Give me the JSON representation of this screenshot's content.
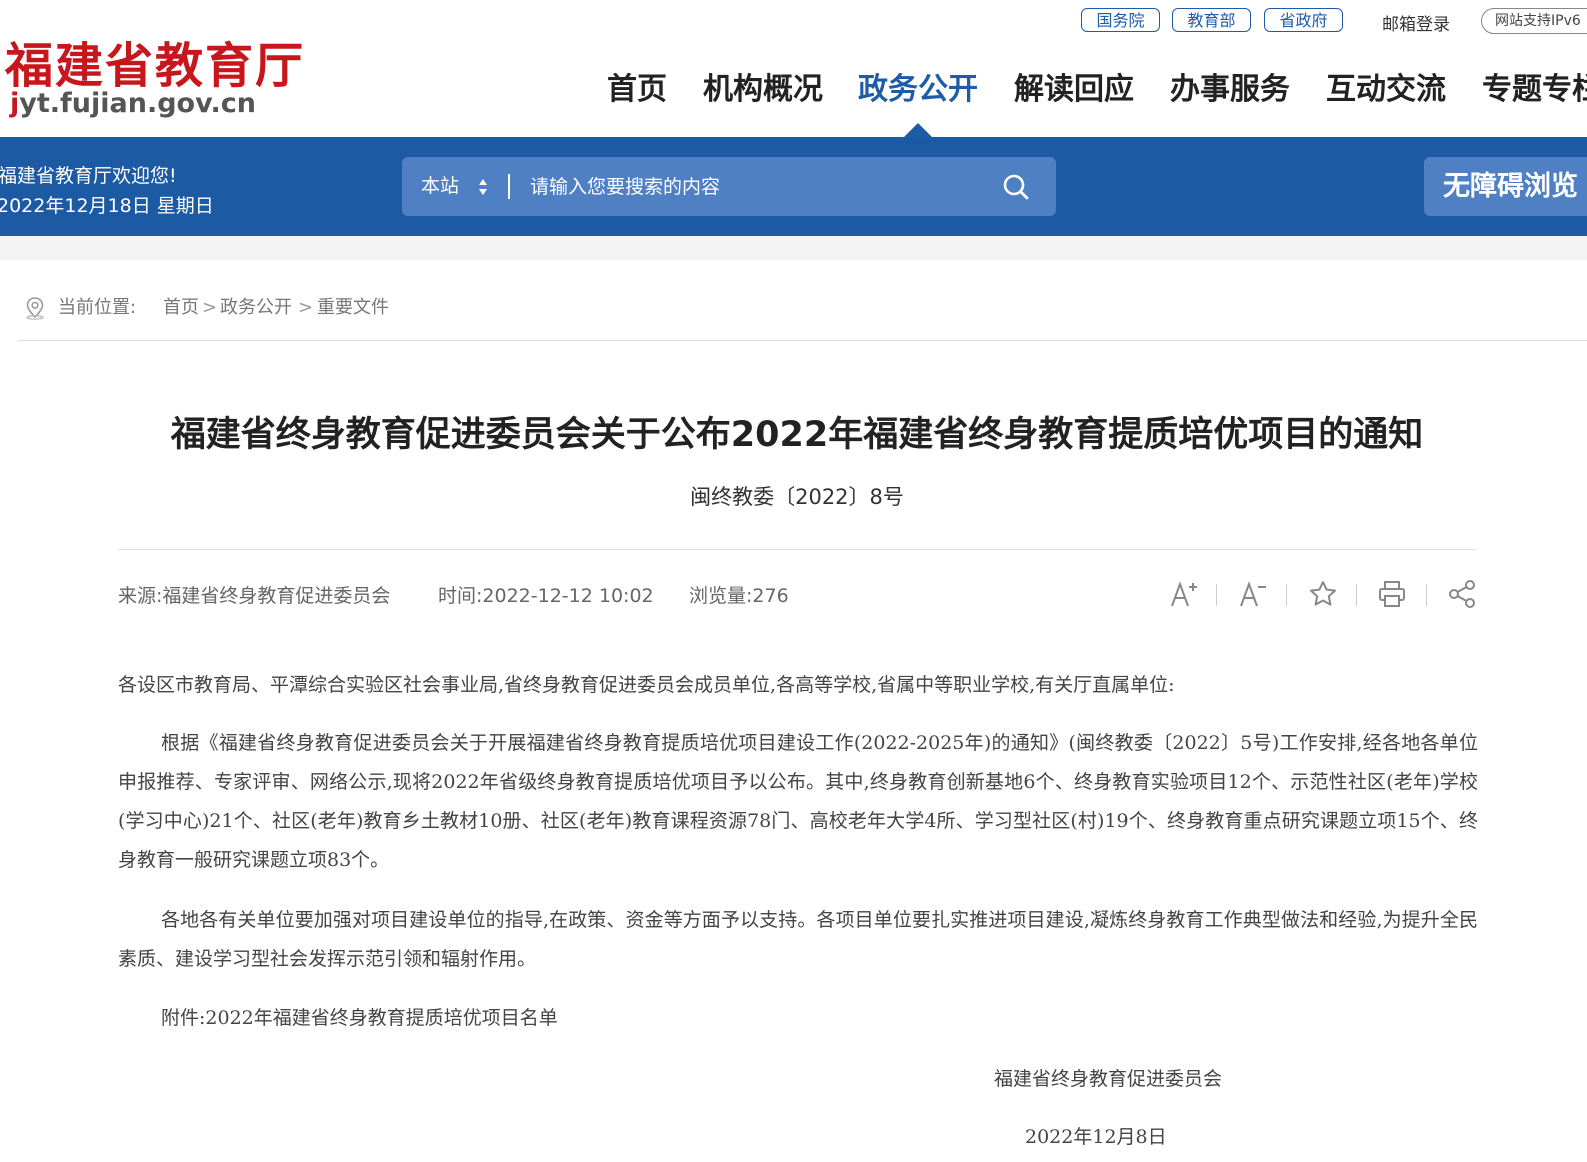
{
  "header": {
    "logo_title": "福建省教育厅",
    "logo_domain_j": "j",
    "logo_domain_rest": "yt.fujian.gov.cn",
    "top_links": [
      "国务院",
      "教育部",
      "省政府"
    ],
    "mail_login": "邮箱登录",
    "ipv6": "网站支持IPv6",
    "nav": [
      "首页",
      "机构概况",
      "政务公开",
      "解读回应",
      "办事服务",
      "互动交流",
      "专题专栏"
    ],
    "nav_active": "政务公开"
  },
  "banner": {
    "welcome_line1": "福建省教育厅欢迎您!",
    "welcome_line2": "2022年12月18日 星期日",
    "search_scope": "本站",
    "search_placeholder": "请输入您要搜索的内容",
    "accessibility": "无障碍浏览"
  },
  "breadcrumb": {
    "label": "当前位置:",
    "items": [
      "首页",
      "政务公开",
      "重要文件"
    ],
    "separator": ">"
  },
  "article": {
    "title": "福建省终身教育促进委员会关于公布2022年福建省终身教育提质培优项目的通知",
    "doc_number": "闽终教委〔2022〕8号",
    "source_label": "来源:",
    "source": "福建省终身教育促进委员会",
    "time_label": "时间:",
    "time": "2022-12-12 10:02",
    "views_label": "浏览量:",
    "views": "276",
    "addressee": "各设区市教育局、平潭综合实验区社会事业局,省终身教育促进委员会成员单位,各高等学校,省属中等职业学校,有关厅直属单位:",
    "para1": "根据《福建省终身教育促进委员会关于开展福建省终身教育提质培优项目建设工作(2022-2025年)的通知》(闽终教委〔2022〕5号)工作安排,经各地各单位申报推荐、专家评审、网络公示,现将2022年省级终身教育提质培优项目予以公布。其中,终身教育创新基地6个、终身教育实验项目12个、示范性社区(老年)学校(学习中心)21个、社区(老年)教育乡土教材10册、社区(老年)教育课程资源78门、高校老年大学4所、学习型社区(村)19个、终身教育重点研究课题立项15个、终身教育一般研究课题立项83个。",
    "para2": "各地各有关单位要加强对项目建设单位的指导,在政策、资金等方面予以支持。各项目单位要扎实推进项目建设,凝炼终身教育工作典型做法和经验,为提升全民素质、建设学习型社会发挥示范引领和辐射作用。",
    "attachment": "附件:2022年福建省终身教育提质培优项目名单",
    "signature": "福建省终身教育促进委员会",
    "sign_date": "2022年12月8日"
  },
  "icons": {
    "font_increase": "font-increase-icon",
    "font_decrease": "font-decrease-icon",
    "favorite": "star-icon",
    "print": "printer-icon",
    "share": "share-icon",
    "search": "search-icon",
    "location": "location-pin-icon"
  },
  "colors": {
    "brand_red": "#c8161d",
    "brand_blue": "#1c5aa3",
    "search_bg": "#4f80c3"
  }
}
